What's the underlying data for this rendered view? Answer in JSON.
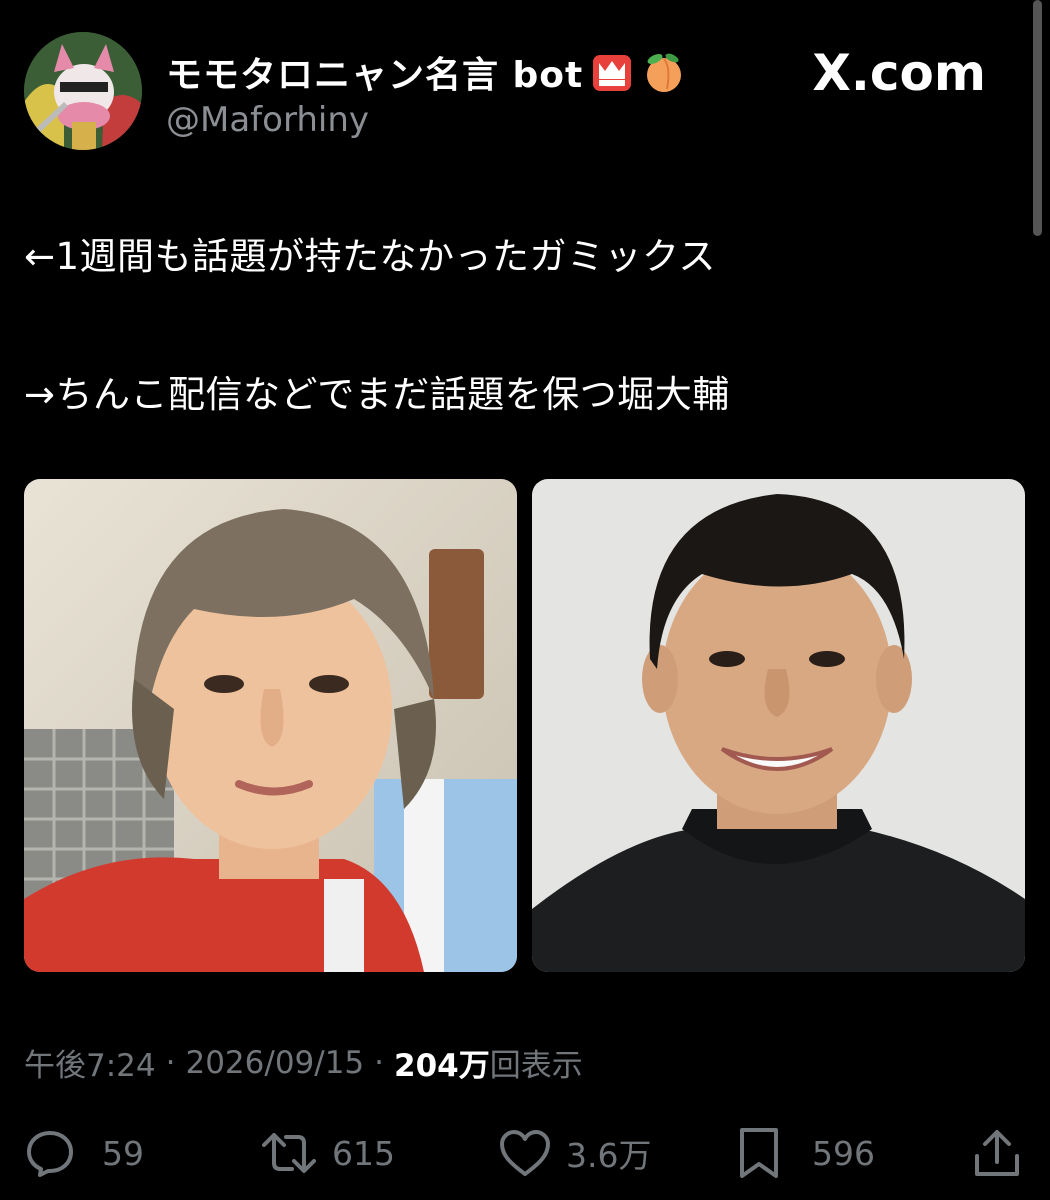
{
  "header": {
    "display_name": "モモタロニャン名言 bot",
    "handle": "@Maforhiny",
    "brand": "X.com",
    "badge_icons": [
      "crown-icon",
      "peach-icon"
    ]
  },
  "tweet": {
    "lines": [
      "←1週間も話題が持たなかったガミックス",
      "→ちんこ配信などでまだ話題を保つ堀大輔"
    ]
  },
  "media": [
    {
      "label": "photo-left"
    },
    {
      "label": "photo-right"
    }
  ],
  "meta": {
    "time": "午後7:24",
    "date": "2026/09/15",
    "views_num": "204万",
    "views_label": "回表示",
    "separator": "·"
  },
  "actions": {
    "replies": "59",
    "reposts": "615",
    "likes": "3.6万",
    "bookmarks": "596"
  },
  "colors": {
    "background": "#000000",
    "text": "#ffffff",
    "muted": "#71767b"
  }
}
